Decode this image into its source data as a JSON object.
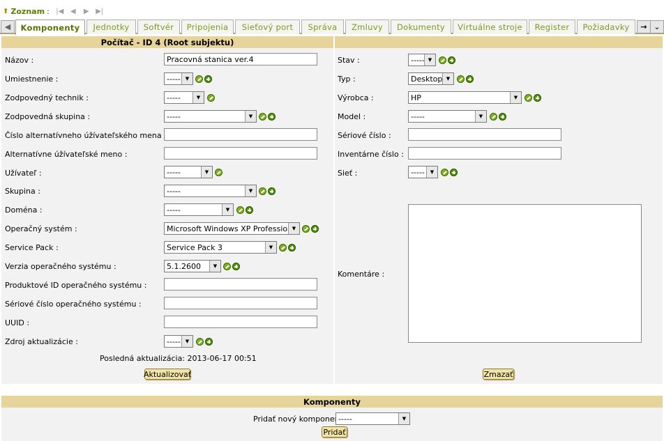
{
  "topnav": {
    "link": "Zoznam",
    "colon": ":"
  },
  "tabs": [
    "Komponenty",
    "Jednotky",
    "Softvér",
    "Pripojenia",
    "Sieťový port",
    "Správa",
    "Zmluvy",
    "Dokumenty",
    "Virtuálne stroje",
    "Register",
    "Požiadavky"
  ],
  "panel": {
    "title": "Počítač - ID 4 (Root subjektu)"
  },
  "left": {
    "name_label": "Názov :",
    "name_value": "Pracovná stanica ver.4",
    "location_label": "Umiestnenie :",
    "location_value": "-----",
    "tech_label": "Zodpovedný technik :",
    "tech_value": "-----",
    "group_resp_label": "Zodpovedná skupina :",
    "group_resp_value": "-----",
    "alt_user_num_label": "Číslo alternatívneho úžívateľského mena :",
    "alt_user_label": "Alternatívne úžívateľské meno :",
    "user_label": "Užívateľ :",
    "user_value": "-----",
    "group_label": "Skupina :",
    "group_value": "-----",
    "domain_label": "Doména :",
    "domain_value": "-----",
    "os_label": "Operačný systém :",
    "os_value": "Microsoft Windows XP Professional",
    "sp_label": "Service Pack :",
    "sp_value": "Service Pack 3",
    "osver_label": "Verzia operačného systému :",
    "osver_value": "5.1.2600",
    "osprod_label": "Produktové ID operačného systému :",
    "osserial_label": "Sériové číslo operačného systému :",
    "uuid_label": "UUID :",
    "src_label": "Zdroj aktualizácie :",
    "src_value": "-----",
    "last_update": "Posledná aktualizácia: 2013-06-17 00:51",
    "update_button": "Aktualizovať"
  },
  "right": {
    "state_label": "Stav :",
    "state_value": "-----",
    "type_label": "Typ :",
    "type_value": "Desktop",
    "maker_label": "Výrobca :",
    "maker_value": "HP",
    "model_label": "Model :",
    "model_value": "-----",
    "serial_label": "Sériové číslo :",
    "inv_label": "Inventárne číslo :",
    "net_label": "Sieť :",
    "net_value": "-----",
    "comment_label": "Komentáre :",
    "delete_button": "Zmazať"
  },
  "components": {
    "title": "Komponenty",
    "add_label": "Pridať nový komponent :",
    "add_value": "-----",
    "add_button": "Pridať"
  }
}
